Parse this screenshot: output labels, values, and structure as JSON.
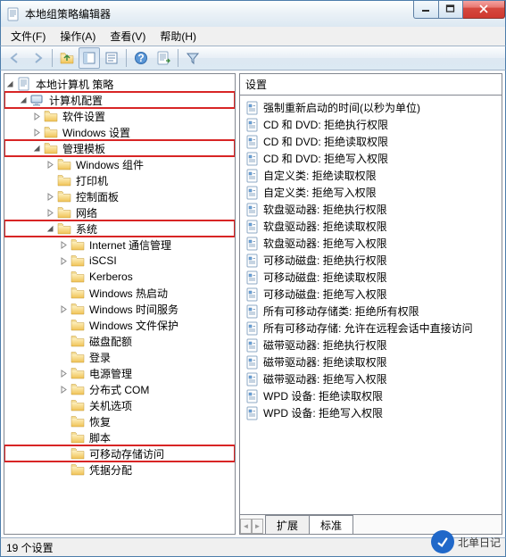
{
  "window": {
    "title": "本地组策略编辑器"
  },
  "menu": {
    "file": "文件(F)",
    "action": "操作(A)",
    "view": "查看(V)",
    "help": "帮助(H)"
  },
  "tree": {
    "root": "本地计算机 策略",
    "computer_config": "计算机配置",
    "software_settings": "软件设置",
    "windows_settings": "Windows 设置",
    "admin_templates": "管理模板",
    "windows_components": "Windows 组件",
    "printers": "打印机",
    "control_panel": "控制面板",
    "network": "网络",
    "system": "系统",
    "internet_comm": "Internet 通信管理",
    "iscsi": "iSCSI",
    "kerberos": "Kerberos",
    "windows_hotstart": "Windows 热启动",
    "windows_time": "Windows 时间服务",
    "windows_fileprotect": "Windows 文件保护",
    "disk_quota": "磁盘配额",
    "logon": "登录",
    "power": "电源管理",
    "dcom": "分布式 COM",
    "shutdown_opts": "关机选项",
    "recovery": "恢复",
    "scripts": "脚本",
    "removable_storage": "可移动存储访问",
    "passport_cred": "凭据分配"
  },
  "right": {
    "header": "设置",
    "tabs": {
      "extended": "扩展",
      "standard": "标准"
    }
  },
  "policies": [
    "强制重新启动的时间(以秒为单位)",
    "CD 和 DVD: 拒绝执行权限",
    "CD 和 DVD: 拒绝读取权限",
    "CD 和 DVD: 拒绝写入权限",
    "自定义类: 拒绝读取权限",
    "自定义类: 拒绝写入权限",
    "软盘驱动器: 拒绝执行权限",
    "软盘驱动器: 拒绝读取权限",
    "软盘驱动器: 拒绝写入权限",
    "可移动磁盘: 拒绝执行权限",
    "可移动磁盘: 拒绝读取权限",
    "可移动磁盘: 拒绝写入权限",
    "所有可移动存储类: 拒绝所有权限",
    "所有可移动存储: 允许在远程会话中直接访问",
    "磁带驱动器: 拒绝执行权限",
    "磁带驱动器: 拒绝读取权限",
    "磁带驱动器: 拒绝写入权限",
    "WPD 设备: 拒绝读取权限",
    "WPD 设备: 拒绝写入权限"
  ],
  "status": {
    "count_text": "19 个设置"
  },
  "watermark": {
    "text": "北单日记"
  }
}
